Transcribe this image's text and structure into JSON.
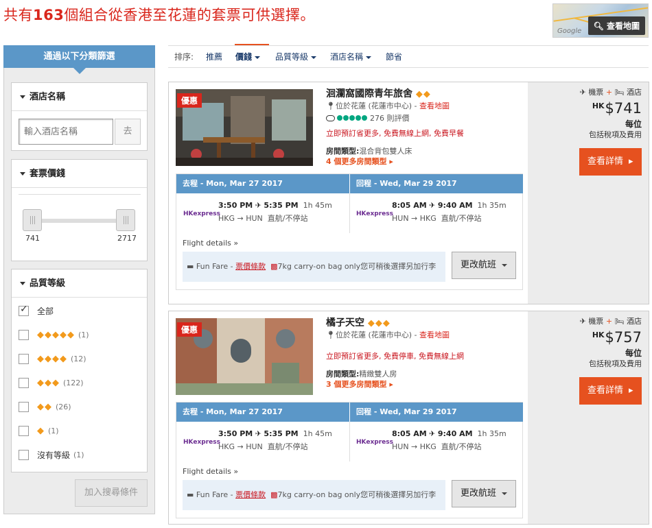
{
  "header": {
    "headline_pre": "共有",
    "headline_count": "163",
    "headline_post": "個組合從香港至花蓮的套票可供選擇。",
    "map_label": "查看地圖",
    "map_logo": "Google"
  },
  "sidebar": {
    "title": "通過以下分類篩選",
    "hotel_name": {
      "title": "酒店名稱",
      "placeholder": "輸入酒店名稱",
      "go_label": "去"
    },
    "price": {
      "title": "套票價錢",
      "min": "741",
      "max": "2717"
    },
    "stars": {
      "title": "品質等級",
      "options": [
        {
          "label": "全部",
          "diamonds": "",
          "count": "",
          "checked": true
        },
        {
          "label": "",
          "diamonds": "◆◆◆◆◆",
          "count": "(1)",
          "checked": false
        },
        {
          "label": "",
          "diamonds": "◆◆◆◆",
          "count": "(12)",
          "checked": false
        },
        {
          "label": "",
          "diamonds": "◆◆◆",
          "count": "(122)",
          "checked": false
        },
        {
          "label": "",
          "diamonds": "◆◆",
          "count": "(26)",
          "checked": false
        },
        {
          "label": "",
          "diamonds": "◆",
          "count": "(1)",
          "checked": false
        },
        {
          "label": "沒有等級",
          "diamonds": "",
          "count": "(1)",
          "checked": false
        }
      ]
    },
    "add_button": "加入搜尋條件"
  },
  "sort": {
    "label": "排序:",
    "options": [
      "推薦",
      "價錢",
      "品質等級",
      "酒店名稱",
      "節省"
    ],
    "active": "價錢"
  },
  "results": [
    {
      "badge": "優惠",
      "name": "洄瀾窩國際青年旅舍",
      "diamonds": "◆◆",
      "location": "位於花蓮 (花蓮市中心)",
      "map_link": "查看地圖",
      "reviews": "276 則評價",
      "perks": "立即預訂省更多, 免費無線上網, 免費早餐",
      "room_label": "房間類型:",
      "room_type": "混合背包雙人床",
      "more_rooms": "4 個更多房間類型",
      "outbound": {
        "header": "去程 - Mon, Mar 27 2017",
        "dep": "3:50 PM",
        "arr": "5:35 PM",
        "duration": "1h 45m",
        "route": "HKG → HUN",
        "stops": "直航/不停站"
      },
      "inbound": {
        "header": "回程 - Wed, Mar 29 2017",
        "dep": "8:05 AM",
        "arr": "9:40 AM",
        "duration": "1h 35m",
        "route": "HUN → HKG",
        "stops": "直航/不停站"
      },
      "flight_details": "Flight details",
      "fare_name": "Fun Fare - ",
      "fare_terms": "票價條款",
      "fare_note": "7kg carry-on bag only您可稍後選擇另加行李",
      "change_flight": "更改航班",
      "pkg_flight": "機票",
      "pkg_hotel": "酒店",
      "currency": "HK",
      "price": "$741",
      "per": "每位",
      "tax": "包括稅項及費用",
      "detail_button": "查看詳情"
    },
    {
      "badge": "優惠",
      "name": "橘子天空",
      "diamonds": "◆◆◆",
      "location": "位於花蓮 (花蓮市中心)",
      "map_link": "查看地圖",
      "reviews": "",
      "perks": "立即預訂省更多, 免費停車, 免費無線上網",
      "room_label": "房間類型:",
      "room_type": "精緻雙人房",
      "more_rooms": "3 個更多房間類型",
      "outbound": {
        "header": "去程 - Mon, Mar 27 2017",
        "dep": "3:50 PM",
        "arr": "5:35 PM",
        "duration": "1h 45m",
        "route": "HKG → HUN",
        "stops": "直航/不停站"
      },
      "inbound": {
        "header": "回程 - Wed, Mar 29 2017",
        "dep": "8:05 AM",
        "arr": "9:40 AM",
        "duration": "1h 35m",
        "route": "HUN → HKG",
        "stops": "直航/不停站"
      },
      "flight_details": "Flight details",
      "fare_name": "Fun Fare - ",
      "fare_terms": "票價條款",
      "fare_note": "7kg carry-on bag only您可稍後選擇另加行李",
      "change_flight": "更改航班",
      "pkg_flight": "機票",
      "pkg_hotel": "酒店",
      "currency": "HK",
      "price": "$757",
      "per": "每位",
      "tax": "包括稅項及費用",
      "detail_button": "查看詳情"
    }
  ],
  "airline": {
    "logo_a": "HK",
    "logo_b": "express"
  },
  "colors": {
    "accent": "#e6511f",
    "brand_blue": "#5b97c8",
    "headline_red": "#d9261c",
    "diamond": "#f29a1c"
  }
}
